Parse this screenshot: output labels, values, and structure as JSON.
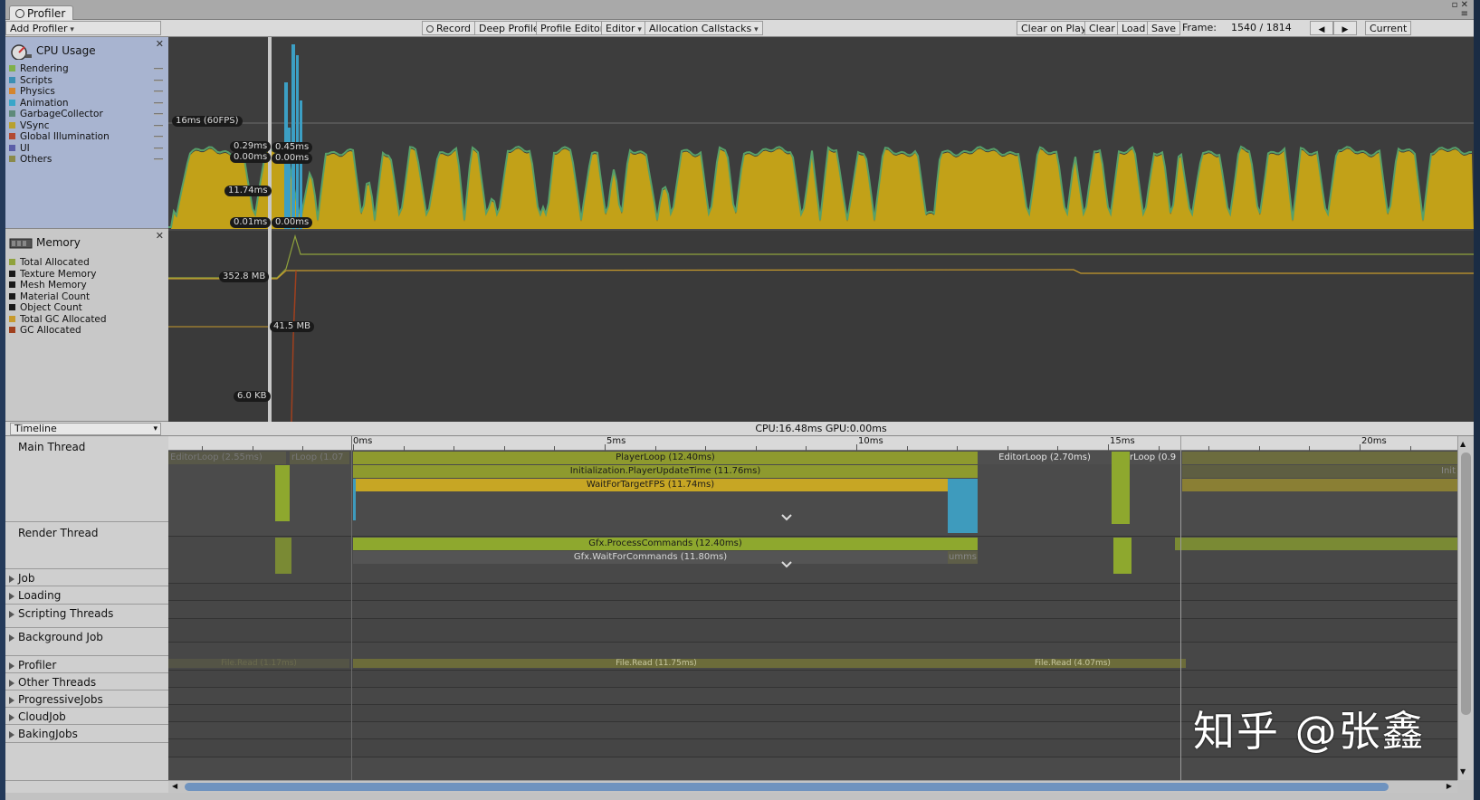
{
  "window": {
    "tab_title": "Profiler",
    "controls": "▫ ✕",
    "menu_icon": "≡"
  },
  "toolbar": {
    "add_profiler": "Add Profiler",
    "record": "Record",
    "deep_profile": "Deep Profile",
    "profile_editor": "Profile Editor",
    "editor": "Editor",
    "allocation_callstacks": "Allocation Callstacks",
    "clear_on_play": "Clear on Play",
    "clear": "Clear",
    "load": "Load",
    "save": "Save",
    "frame_label": "Frame:",
    "frame_value": "1540 / 1814",
    "prev": "◀",
    "next": "▶",
    "current": "Current"
  },
  "cpu_module": {
    "title": "CPU Usage",
    "legend": [
      {
        "name": "Rendering",
        "color": "#7fb04a"
      },
      {
        "name": "Scripts",
        "color": "#3c8fb4"
      },
      {
        "name": "Physics",
        "color": "#d4852f"
      },
      {
        "name": "Animation",
        "color": "#3aa6c9"
      },
      {
        "name": "GarbageCollector",
        "color": "#5e8a7a"
      },
      {
        "name": "VSync",
        "color": "#b8a12f"
      },
      {
        "name": "Global Illumination",
        "color": "#b24a32"
      },
      {
        "name": "UI",
        "color": "#5b5ea8"
      },
      {
        "name": "Others",
        "color": "#8a8a4a"
      }
    ],
    "labels": {
      "fps_line": "16ms (60FPS)",
      "a": "0.29ms",
      "b": "0.45ms",
      "c": "0.00ms",
      "d": "0.00ms",
      "e": "11.74ms",
      "f": "0.01ms",
      "g": "0.00ms"
    },
    "fill_color": "#c2a118"
  },
  "memory_module": {
    "title": "Memory",
    "legend": [
      {
        "name": "Total Allocated",
        "color": "#8fa23c"
      },
      {
        "name": "Texture Memory",
        "color": "#1a1a1a"
      },
      {
        "name": "Mesh Memory",
        "color": "#1a1a1a"
      },
      {
        "name": "Material Count",
        "color": "#1a1a1a"
      },
      {
        "name": "Object Count",
        "color": "#1a1a1a"
      },
      {
        "name": "Total GC Allocated",
        "color": "#c79a2c"
      },
      {
        "name": "GC Allocated",
        "color": "#a0401e"
      }
    ],
    "labels": {
      "a": "352.8 MB",
      "b": "41.5 MB",
      "c": "6.0 KB"
    }
  },
  "timeline": {
    "view_select": "Timeline",
    "cpu_gpu": "CPU:16.48ms   GPU:0.00ms",
    "ruler": [
      "0ms",
      "5ms",
      "10ms",
      "15ms",
      "20ms"
    ],
    "threads": [
      {
        "name": "Main Thread"
      },
      {
        "name": "Render Thread"
      },
      {
        "name": "Job"
      },
      {
        "name": "Loading"
      },
      {
        "name": "Scripting Threads"
      },
      {
        "name": "Background Job"
      },
      {
        "name": "Profiler"
      },
      {
        "name": "Other Threads"
      },
      {
        "name": "ProgressiveJobs"
      },
      {
        "name": "CloudJob"
      },
      {
        "name": "BakingJobs"
      }
    ],
    "blocks": {
      "editor_loop_left": "EditorLoop (2.55ms)",
      "rloop_left": "rLoop (1.07",
      "player_loop": "PlayerLoop (12.40ms)",
      "init_update": "Initialization.PlayerUpdateTime (11.76ms)",
      "wait_fps": "WaitForTargetFPS (11.74ms)",
      "editor_loop_right": "EditorLoop (2.70ms)",
      "rloop_right": "rLoop (0.9",
      "init_right": "Init",
      "gfx_process": "Gfx.ProcessCommands (12.40ms)",
      "gfx_wait": "Gfx.WaitForCommands (11.80ms)",
      "gfx_small": "umms",
      "file_read_left": "File.Read (1.17ms)",
      "file_read_mid": "File.Read (11.75ms)",
      "file_read_right": "File.Read (4.07ms)"
    }
  },
  "watermark": "知乎 @张鑫"
}
